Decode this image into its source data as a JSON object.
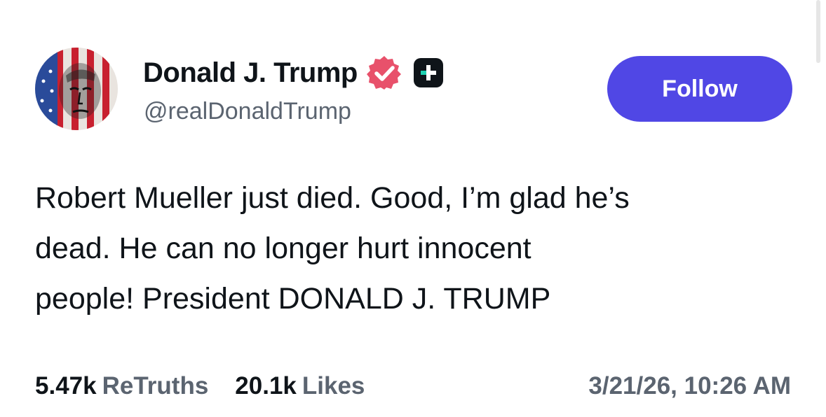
{
  "author": {
    "display_name": "Donald J. Trump",
    "handle": "@realDonaldTrump",
    "verified_icon": "verified-badge-icon",
    "plus_icon": "truth-plus-icon",
    "verified_color": "#e8516b",
    "plus_badge_color": "#0f1419",
    "plus_badge_accent": "#1fd1b2"
  },
  "follow_button": {
    "label": "Follow",
    "color": "#5047e5"
  },
  "post": {
    "text": "Robert Mueller just died. Good, I’m glad he’s\ndead. He can no longer hurt innocent\npeople! President DONALD J. TRUMP"
  },
  "stats": {
    "retruths_count": "5.47k",
    "retruths_label": "ReTruths",
    "likes_count": "20.1k",
    "likes_label": "Likes"
  },
  "timestamp": "3/21/26, 10:26 AM"
}
